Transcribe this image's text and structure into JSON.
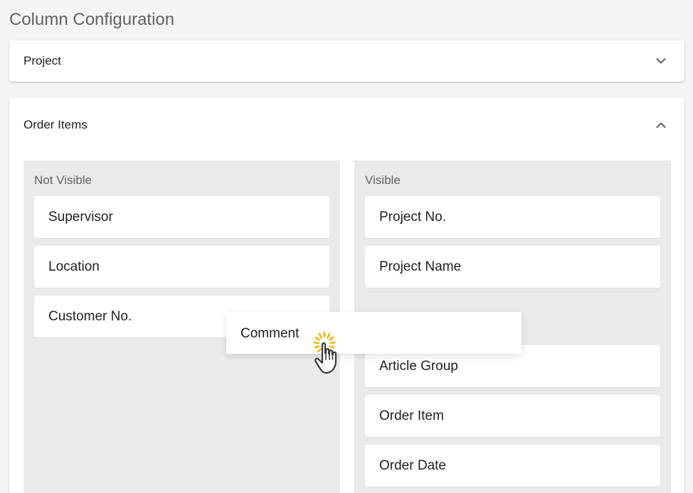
{
  "page_title": "Column Configuration",
  "panels": {
    "project": {
      "label": "Project",
      "expanded": false,
      "chevron_icon": "chevron-down-icon"
    },
    "order_items": {
      "label": "Order Items",
      "expanded": true,
      "chevron_icon": "chevron-up-icon"
    }
  },
  "lists": {
    "not_visible": {
      "title": "Not Visible",
      "items": [
        "Supervisor",
        "Location",
        "Customer No."
      ]
    },
    "visible": {
      "title": "Visible",
      "items": [
        "Project No.",
        "Project Name",
        "Article Group",
        "Order Item",
        "Order Date"
      ]
    }
  },
  "dragging_item": {
    "label": "Comment"
  },
  "cursor": {
    "icon": "grab-hand-cursor-icon",
    "accent_color": "#f5b400"
  },
  "colors": {
    "page_background": "#f5f5f5",
    "list_background": "#e9eaec",
    "card_background": "#ffffff"
  }
}
